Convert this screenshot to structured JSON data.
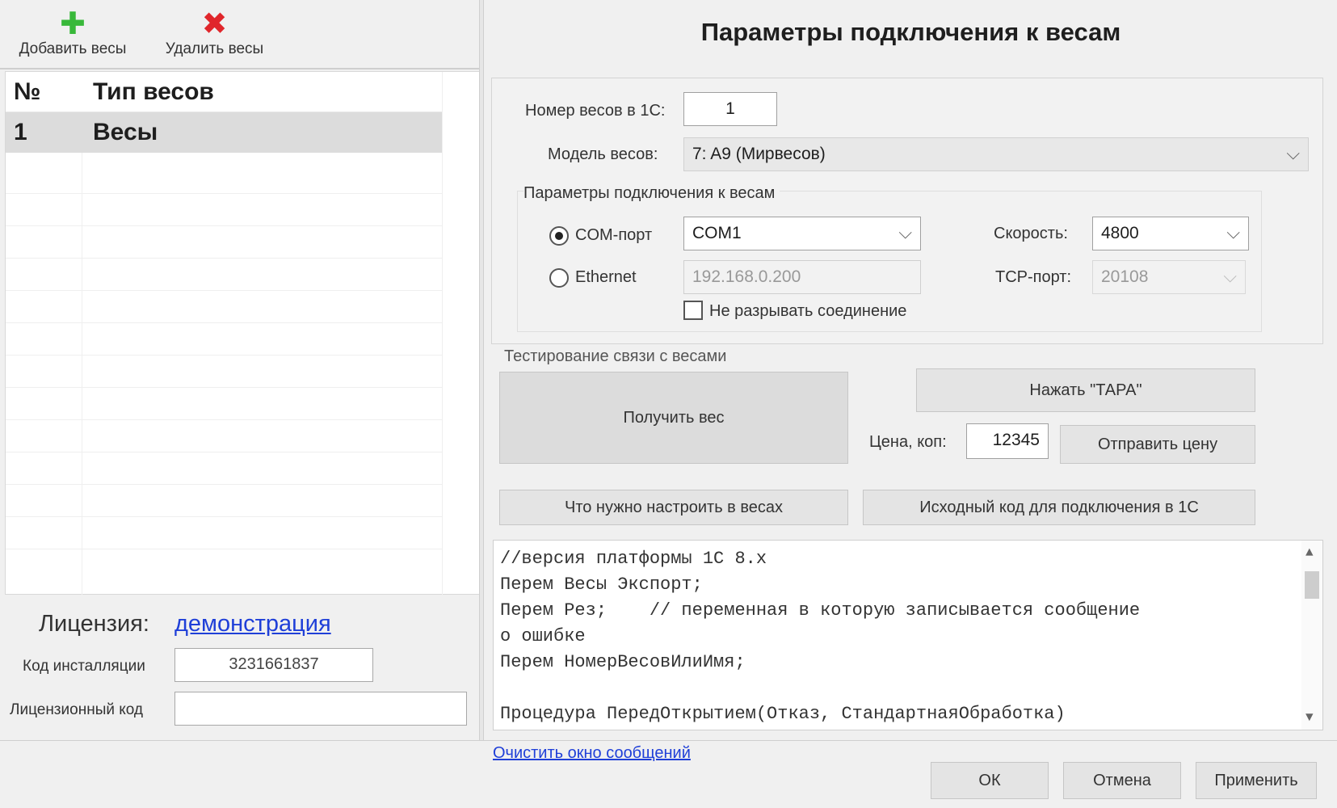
{
  "toolbar": {
    "add_label": "Добавить весы",
    "delete_label": "Удалить весы"
  },
  "grid": {
    "columns": [
      "№",
      "Тип весов"
    ],
    "rows": [
      {
        "num": "1",
        "type": "Весы"
      }
    ]
  },
  "license": {
    "label": "Лицензия:",
    "mode_link": "демонстрация",
    "install_code_label": "Код инсталляции",
    "install_code_value": "3231661837",
    "license_code_label": "Лицензионный код",
    "license_code_value": ""
  },
  "form": {
    "title": "Параметры подключения к весам",
    "scale_number_label": "Номер весов в 1С:",
    "scale_number_value": "1",
    "model_label": "Модель весов:",
    "model_value": "7:  A9  (Мирвесов)",
    "conn_group_label": "Параметры подключения к весам",
    "com_label": "COM-порт",
    "com_value": "COM1",
    "ethernet_label": "Ethernet",
    "ip_value": "192.168.0.200",
    "speed_label": "Скорость:",
    "speed_value": "4800",
    "tcp_label": "TCP-порт:",
    "tcp_value": "20108",
    "keep_conn_label": "Не разрывать соединение",
    "test_group_label": "Тестирование связи с весами",
    "get_weight_btn": "Получить вес",
    "tare_btn": "Нажать \"ТАРА\"",
    "price_label": "Цена, коп:",
    "price_value": "12345",
    "send_price_btn": "Отправить цену",
    "setup_btn": "Что нужно настроить в весах",
    "source_btn": "Исходный код для подключения в 1С"
  },
  "code_lines": [
    "//версия платформы 1С 8.х",
    "Перем Весы Экспорт;",
    "Перем Рез;    // переменная в которую записывается сообщение",
    "о ошибке",
    "Перем НомерВесовИлиИмя;",
    "",
    "Процедура ПередОткрытием(Отказ, СтандартнаяОбработка)"
  ],
  "bottom": {
    "clear_link": "Очистить окно сообщений",
    "ok": "ОК",
    "cancel": "Отмена",
    "apply": "Применить"
  },
  "colors": {
    "add_icon": "#38b83a",
    "delete_icon": "#e0262b",
    "link": "#1f3fd8"
  }
}
